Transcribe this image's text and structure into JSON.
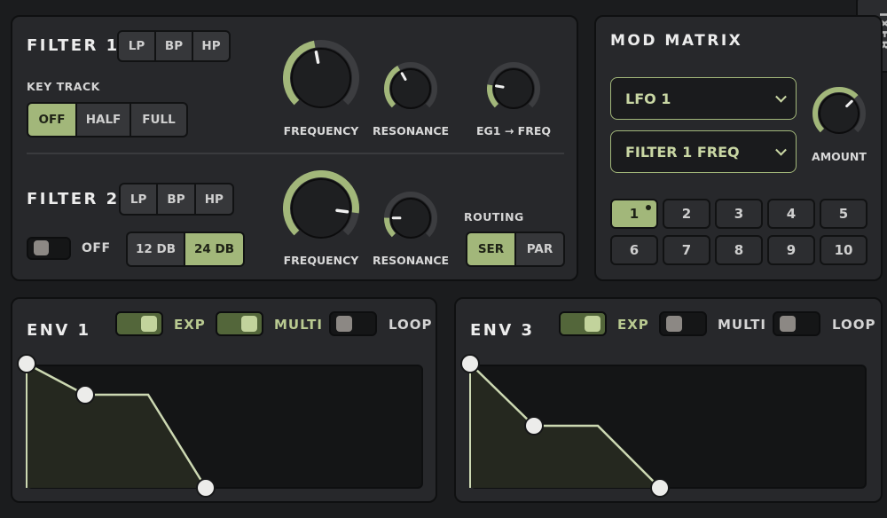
{
  "filter1": {
    "title": "FILTER 1",
    "modes": [
      "LP",
      "BP",
      "HP"
    ],
    "active_mode": 0,
    "keytrack": {
      "label": "KEY TRACK",
      "options": [
        "OFF",
        "HALF",
        "FULL"
      ],
      "active": 0
    },
    "knobs": [
      {
        "label": "FREQUENCY",
        "value": 0.46
      },
      {
        "label": "RESONANCE",
        "value": 0.39
      },
      {
        "label": "EG1 → FREQ",
        "value": 0.2
      }
    ]
  },
  "filter2": {
    "title": "FILTER 2",
    "modes": [
      "LP",
      "BP",
      "HP"
    ],
    "active_mode": 0,
    "enable": {
      "label": "OFF",
      "on": false
    },
    "slope": {
      "options": [
        "12 DB",
        "24 DB"
      ],
      "active": 1
    },
    "knobs": [
      {
        "label": "FREQUENCY",
        "value": 0.86
      },
      {
        "label": "RESONANCE",
        "value": 0.17
      }
    ],
    "routing": {
      "label": "ROUTING",
      "options": [
        "SER",
        "PAR"
      ],
      "active": 0
    }
  },
  "mod_matrix": {
    "title": "MOD MATRIX",
    "source": "LFO 1",
    "destination": "FILTER 1 FREQ",
    "amount": {
      "label": "AMOUNT",
      "value": 0.67
    },
    "slots": [
      "1",
      "2",
      "3",
      "4",
      "5",
      "6",
      "7",
      "8",
      "9",
      "10"
    ],
    "active_slot": 0
  },
  "side_tab": {
    "label": "IXER"
  },
  "env1": {
    "title": "ENV 1",
    "toggles": [
      {
        "label": "EXP",
        "on": true
      },
      {
        "label": "MULTI",
        "on": true
      },
      {
        "label": "LOOP",
        "on": false
      }
    ]
  },
  "env3": {
    "title": "ENV 3",
    "toggles": [
      {
        "label": "EXP",
        "on": true
      },
      {
        "label": "MULTI",
        "on": false
      },
      {
        "label": "LOOP",
        "on": false
      }
    ]
  },
  "colors": {
    "accent": "#a2b77a",
    "panel": "#27282b",
    "background": "#1b1c1e",
    "knob_track": "#3c3d40",
    "knob_body": "#1e1f21"
  }
}
